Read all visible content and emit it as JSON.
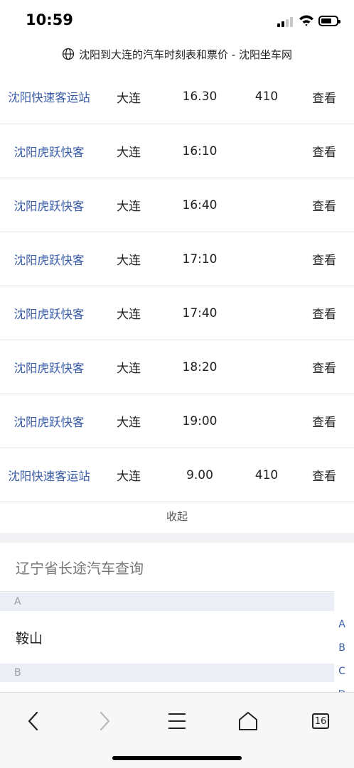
{
  "status": {
    "time": "10:59"
  },
  "url_bar": {
    "title": "沈阳到大连的汽车时刻表和票价 - 沈阳坐车网"
  },
  "schedule": {
    "rows": [
      {
        "station": "沈阳快速客运站",
        "dest": "大连",
        "time": "16.30",
        "price": "410",
        "action": "查看"
      },
      {
        "station": "沈阳虎跃快客",
        "dest": "大连",
        "time": "16:10",
        "price": "",
        "action": "查看"
      },
      {
        "station": "沈阳虎跃快客",
        "dest": "大连",
        "time": "16:40",
        "price": "",
        "action": "查看"
      },
      {
        "station": "沈阳虎跃快客",
        "dest": "大连",
        "time": "17:10",
        "price": "",
        "action": "查看"
      },
      {
        "station": "沈阳虎跃快客",
        "dest": "大连",
        "time": "17:40",
        "price": "",
        "action": "查看"
      },
      {
        "station": "沈阳虎跃快客",
        "dest": "大连",
        "time": "18:20",
        "price": "",
        "action": "查看"
      },
      {
        "station": "沈阳虎跃快客",
        "dest": "大连",
        "time": "19:00",
        "price": "",
        "action": "查看"
      },
      {
        "station": "沈阳快速客运站",
        "dest": "大连",
        "time": "9.00",
        "price": "410",
        "action": "查看"
      }
    ],
    "collapse_label": "收起"
  },
  "province": {
    "title": "辽宁省长途汽车查询",
    "groups": [
      {
        "letter": "A",
        "cities": [
          "鞍山"
        ]
      },
      {
        "letter": "B",
        "cities": []
      }
    ],
    "index": [
      "A",
      "B",
      "C",
      "D"
    ]
  },
  "toolbar": {
    "tab_count": "16"
  },
  "colors": {
    "link": "#3b5ea8",
    "section_bg": "#eceef5"
  }
}
